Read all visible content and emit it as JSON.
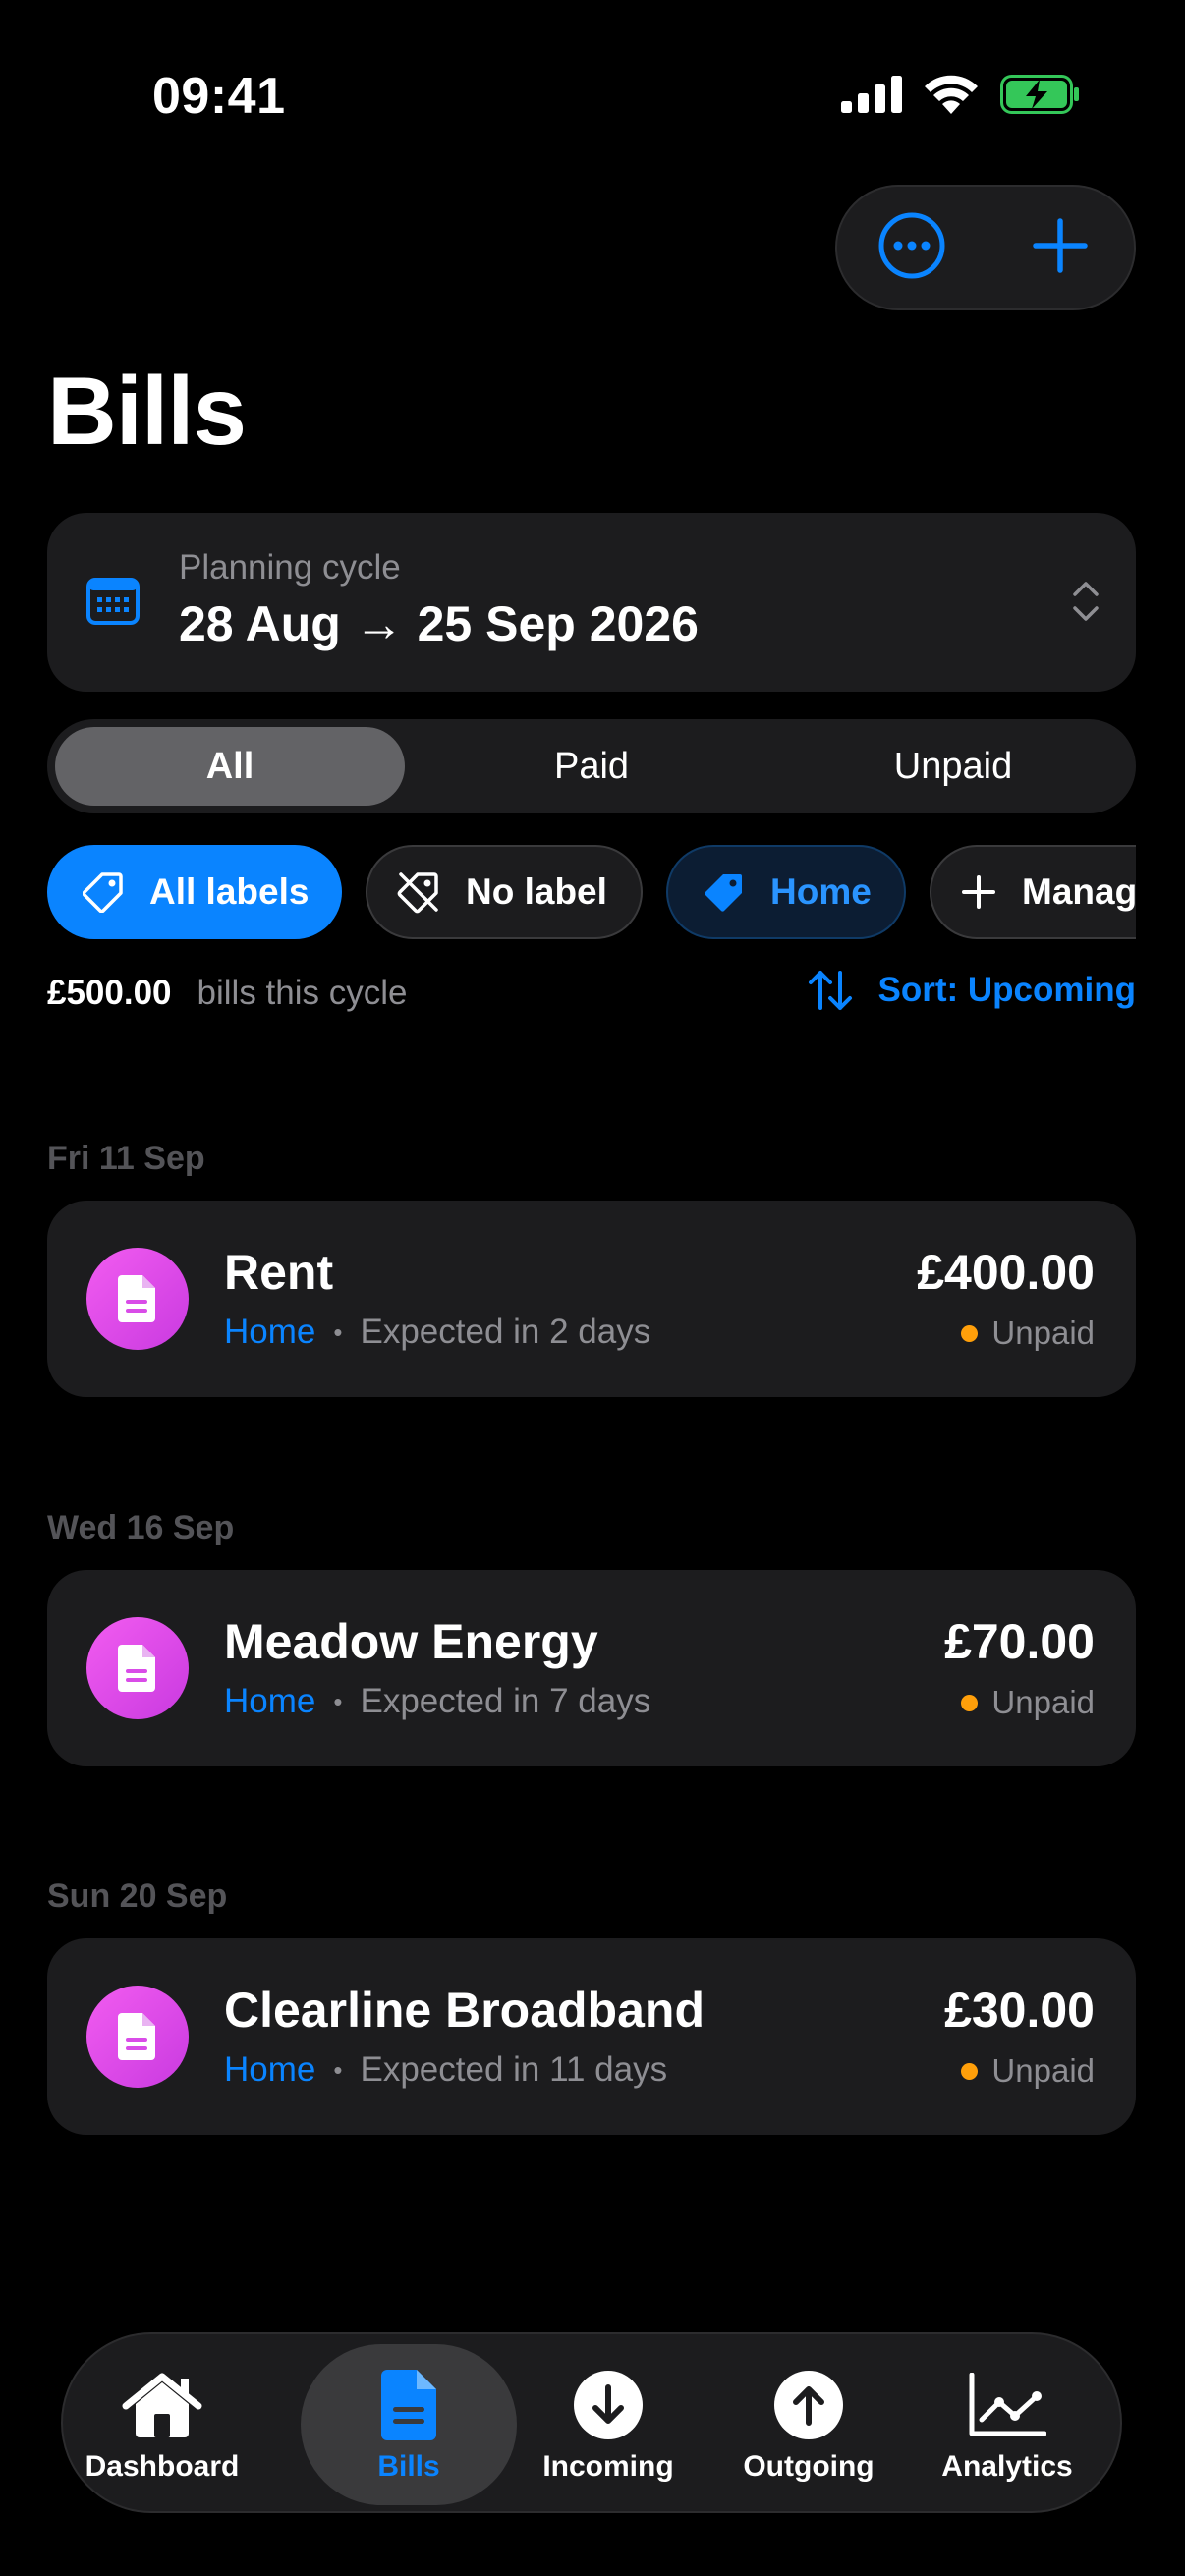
{
  "status_bar": {
    "time": "09:41"
  },
  "page": {
    "title": "Bills"
  },
  "cycle": {
    "label": "Planning cycle",
    "range": "28 Aug → 25 Sep 2026"
  },
  "segments": [
    {
      "label": "All",
      "active": true
    },
    {
      "label": "Paid",
      "active": false
    },
    {
      "label": "Unpaid",
      "active": false
    }
  ],
  "chips": {
    "all_labels": "All labels",
    "no_label": "No label",
    "home": "Home",
    "manage": "Manage"
  },
  "summary": {
    "amount": "£500.00",
    "text": "bills this cycle",
    "sort": "Sort: Upcoming"
  },
  "sections": [
    {
      "date": "Fri 11 Sep",
      "bill": {
        "name": "Rent",
        "label": "Home",
        "expected": "Expected in 2 days",
        "amount": "£400.00",
        "status": "Unpaid"
      }
    },
    {
      "date": "Wed 16 Sep",
      "bill": {
        "name": "Meadow Energy",
        "label": "Home",
        "expected": "Expected in 7 days",
        "amount": "£70.00",
        "status": "Unpaid"
      }
    },
    {
      "date": "Sun 20 Sep",
      "bill": {
        "name": "Clearline Broadband",
        "label": "Home",
        "expected": "Expected in 11 days",
        "amount": "£30.00",
        "status": "Unpaid"
      }
    }
  ],
  "tabs": [
    {
      "label": "Dashboard",
      "icon": "house-icon"
    },
    {
      "label": "Bills",
      "icon": "document-icon",
      "active": true
    },
    {
      "label": "Incoming",
      "icon": "arrow-down-circle-icon"
    },
    {
      "label": "Outgoing",
      "icon": "arrow-up-circle-icon"
    },
    {
      "label": "Analytics",
      "icon": "chart-line-icon"
    }
  ],
  "colors": {
    "accent": "#0a84ff",
    "unpaid": "#ff9f0a",
    "bill_icon": "#e04cf0",
    "battery": "#34c759"
  }
}
